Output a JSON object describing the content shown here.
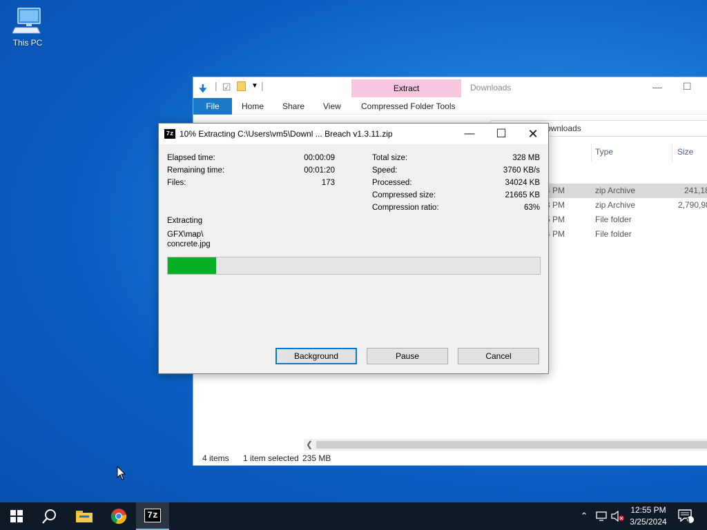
{
  "desktop": {
    "icons": [
      {
        "label": "This PC",
        "icon": "this-pc-icon"
      }
    ]
  },
  "explorer": {
    "window_title": "Downloads",
    "contextual_tab": "Extract",
    "ribbon_tabs": [
      "File",
      "Home",
      "Share",
      "View",
      "Compressed Folder Tools"
    ],
    "address_tail": "ownloads",
    "columns": [
      "Type",
      "Size"
    ],
    "rows": [
      {
        "time": "4 PM",
        "type": "zip Archive",
        "size": "241,18",
        "selected": true
      },
      {
        "time": "3 PM",
        "type": "zip Archive",
        "size": "2,790,98",
        "selected": false
      },
      {
        "time": "5 PM",
        "type": "File folder",
        "size": "",
        "selected": false
      },
      {
        "time": "4 PM",
        "type": "File folder",
        "size": "",
        "selected": false
      }
    ],
    "status": {
      "items": "4 items",
      "selected": "1 item selected",
      "size": "235 MB"
    }
  },
  "dialog": {
    "title": "10% Extracting C:\\Users\\vm5\\Downl ... Breach v1.3.11.zip",
    "left_stats": [
      {
        "label": "Elapsed time:",
        "value": "00:00:09"
      },
      {
        "label": "Remaining time:",
        "value": "00:01:20"
      },
      {
        "label": "Files:",
        "value": "173"
      }
    ],
    "right_stats": [
      {
        "label": "Total size:",
        "value": "328 MB"
      },
      {
        "label": "Speed:",
        "value": "3760 KB/s"
      },
      {
        "label": "Processed:",
        "value": "34024 KB"
      },
      {
        "label": "Compressed size:",
        "value": "21665 KB"
      },
      {
        "label": "Compression ratio:",
        "value": "63%"
      }
    ],
    "operation": "Extracting",
    "current_path": "GFX\\map\\",
    "current_file": "concrete.jpg",
    "progress_fraction": 0.13,
    "buttons": {
      "background": "Background",
      "pause": "Pause",
      "cancel": "Cancel"
    }
  },
  "taskbar": {
    "apps": [
      "start-icon",
      "search-icon",
      "file-explorer-icon",
      "chrome-icon",
      "7zip-icon"
    ],
    "clock_time": "12:55 PM",
    "clock_date": "3/25/2024",
    "notification_count": "1"
  },
  "colors": {
    "accent": "#0078d7",
    "progress": "#06b025",
    "file_tab": "#1979ca",
    "extract_tab": "#f9c6df"
  }
}
